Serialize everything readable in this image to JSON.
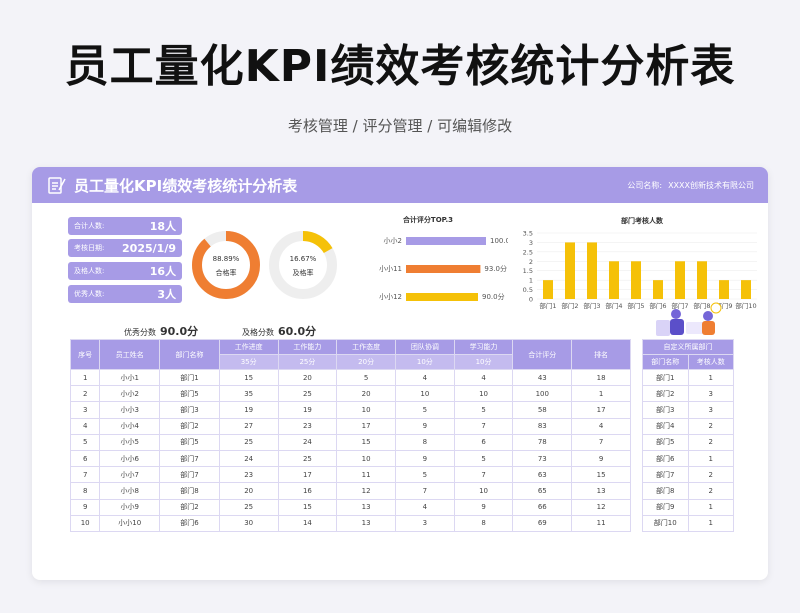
{
  "page": {
    "title": "员工量化KPI绩效考核统计分析表",
    "subtitle": "考核管理 / 评分管理 / 可编辑修改"
  },
  "header": {
    "title": "员工量化KPI绩效考核统计分析表",
    "company_label": "公司名称:",
    "company_name": "XXXX创新技术有限公司",
    "icon": "document-edit-icon"
  },
  "kpis": [
    {
      "label": "合计人数:",
      "value": "18人"
    },
    {
      "label": "考核日期:",
      "value": "2025/1/9"
    },
    {
      "label": "及格人数:",
      "value": "16人"
    },
    {
      "label": "优秀人数:",
      "value": "3人"
    }
  ],
  "donuts": [
    {
      "pct_text": "88.89%",
      "label": "合格率",
      "value": 0.8889,
      "color": "#ef7e32"
    },
    {
      "pct_text": "16.67%",
      "label": "及格率",
      "value": 0.1667,
      "color": "#f5c108"
    }
  ],
  "summary": {
    "excellent_label": "优秀分数",
    "excellent_value": "90.0分",
    "pass_label": "及格分数",
    "pass_value": "60.0分"
  },
  "chart_data": [
    {
      "type": "bar",
      "title": "合计评分TOP.3",
      "orientation": "horizontal",
      "categories": [
        "小小2",
        "小小11",
        "小小12"
      ],
      "values": [
        100,
        93,
        90
      ],
      "value_labels": [
        "100.0分",
        "93.0分",
        "90.0分"
      ],
      "colors": [
        "#a79be6",
        "#ef7e32",
        "#f5c108"
      ],
      "xlim": [
        0,
        100
      ]
    },
    {
      "type": "bar",
      "title": "部门考核人数",
      "categories": [
        "部门1",
        "部门2",
        "部门3",
        "部门4",
        "部门5",
        "部门6",
        "部门7",
        "部门8",
        "部门9",
        "部门10"
      ],
      "values": [
        1,
        3,
        3,
        2,
        2,
        1,
        2,
        2,
        1,
        1
      ],
      "ylim": [
        0,
        3.5
      ],
      "yticks": [
        "0",
        "0.5",
        "1",
        "1.5",
        "2",
        "2.5",
        "3",
        "3.5"
      ],
      "color": "#f5c108"
    }
  ],
  "table": {
    "headers": [
      "序号",
      "员工姓名",
      "部门名称",
      "工作进度",
      "工作能力",
      "工作态度",
      "团队协调",
      "学习能力",
      "合计评分",
      "排名"
    ],
    "weights": [
      "35分",
      "25分",
      "20分",
      "10分",
      "10分"
    ],
    "rows": [
      [
        "1",
        "小小1",
        "部门1",
        "15",
        "20",
        "5",
        "4",
        "4",
        "43",
        "18"
      ],
      [
        "2",
        "小小2",
        "部门5",
        "35",
        "25",
        "20",
        "10",
        "10",
        "100",
        "1"
      ],
      [
        "3",
        "小小3",
        "部门3",
        "19",
        "19",
        "10",
        "5",
        "5",
        "58",
        "17"
      ],
      [
        "4",
        "小小4",
        "部门2",
        "27",
        "23",
        "17",
        "9",
        "7",
        "83",
        "4"
      ],
      [
        "5",
        "小小5",
        "部门5",
        "25",
        "24",
        "15",
        "8",
        "6",
        "78",
        "7"
      ],
      [
        "6",
        "小小6",
        "部门7",
        "24",
        "25",
        "10",
        "9",
        "5",
        "73",
        "9"
      ],
      [
        "7",
        "小小7",
        "部门7",
        "23",
        "17",
        "11",
        "5",
        "7",
        "63",
        "15"
      ],
      [
        "8",
        "小小8",
        "部门8",
        "20",
        "16",
        "12",
        "7",
        "10",
        "65",
        "13"
      ],
      [
        "9",
        "小小9",
        "部门2",
        "25",
        "15",
        "13",
        "4",
        "9",
        "66",
        "12"
      ],
      [
        "10",
        "小小10",
        "部门6",
        "30",
        "14",
        "13",
        "3",
        "8",
        "69",
        "11"
      ]
    ]
  },
  "side_table": {
    "title": "自定义所属部门",
    "headers": [
      "部门名称",
      "考核人数"
    ],
    "rows": [
      [
        "部门1",
        "1"
      ],
      [
        "部门2",
        "3"
      ],
      [
        "部门3",
        "3"
      ],
      [
        "部门4",
        "2"
      ],
      [
        "部门5",
        "2"
      ],
      [
        "部门6",
        "1"
      ],
      [
        "部门7",
        "2"
      ],
      [
        "部门8",
        "2"
      ],
      [
        "部门9",
        "1"
      ],
      [
        "部门10",
        "1"
      ]
    ]
  }
}
